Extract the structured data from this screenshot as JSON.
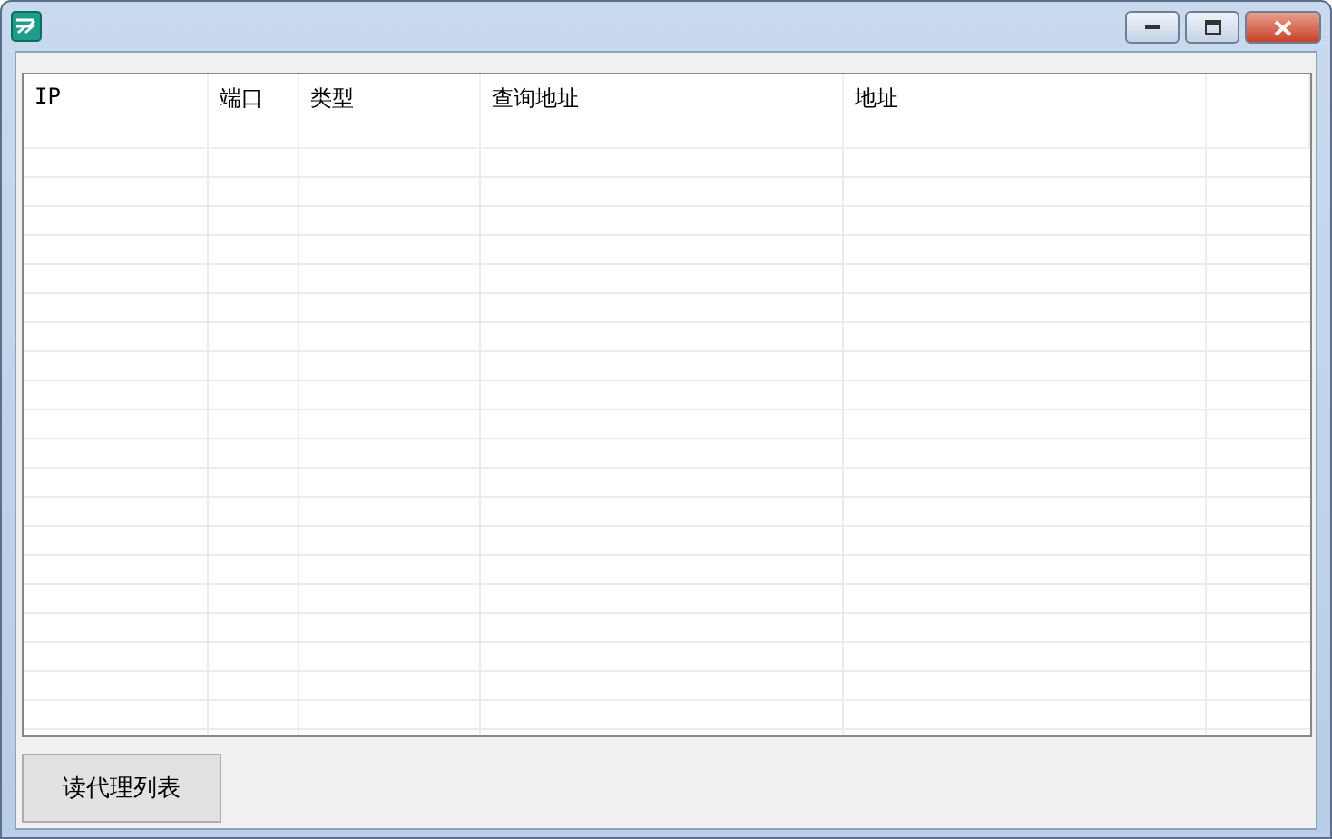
{
  "table": {
    "columns": [
      "IP",
      "端口",
      "类型",
      "查询地址",
      "地址"
    ]
  },
  "buttons": [
    "读代理列表"
  ]
}
